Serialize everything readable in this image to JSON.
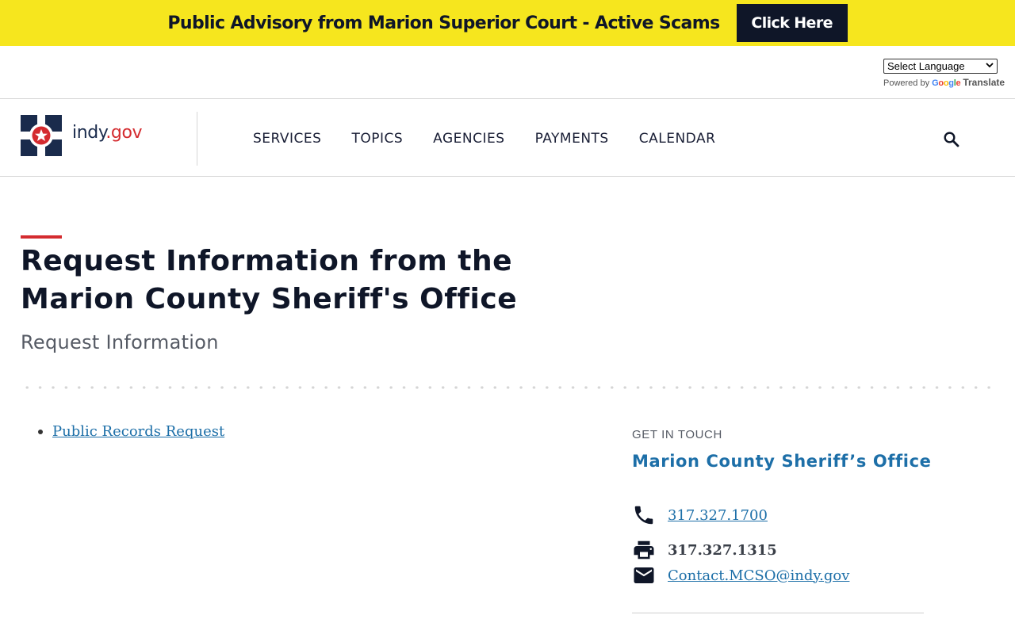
{
  "advisory": {
    "text": "Public Advisory from Marion Superior Court - Active Scams",
    "button_label": "Click Here"
  },
  "translate": {
    "select_value": "Select Language",
    "powered_by": "Powered by",
    "google": [
      "G",
      "o",
      "o",
      "g",
      "l",
      "e"
    ],
    "translate_word": "Translate"
  },
  "header": {
    "logo_word_main": "indy",
    "logo_word_tld": ".gov",
    "nav": [
      "SERVICES",
      "TOPICS",
      "AGENCIES",
      "PAYMENTS",
      "CALENDAR"
    ]
  },
  "page": {
    "title": "Request Information from the Marion County Sheriff's Office",
    "subtitle": "Request Information",
    "links": [
      "Public Records Request"
    ]
  },
  "sidebar": {
    "label": "GET IN TOUCH",
    "org": "Marion County Sheriff’s Office",
    "phone": "317.327.1700",
    "fax": "317.327.1315",
    "email": "Contact.MCSO@indy.gov"
  },
  "colors": {
    "advisory_bg": "#f6e61e",
    "navy": "#0f1628",
    "accent_red": "#d42b2f",
    "link_blue": "#1d6fa8"
  },
  "icons": {
    "search": "search-icon",
    "phone": "phone-icon",
    "fax": "printer-icon",
    "email": "envelope-icon"
  }
}
